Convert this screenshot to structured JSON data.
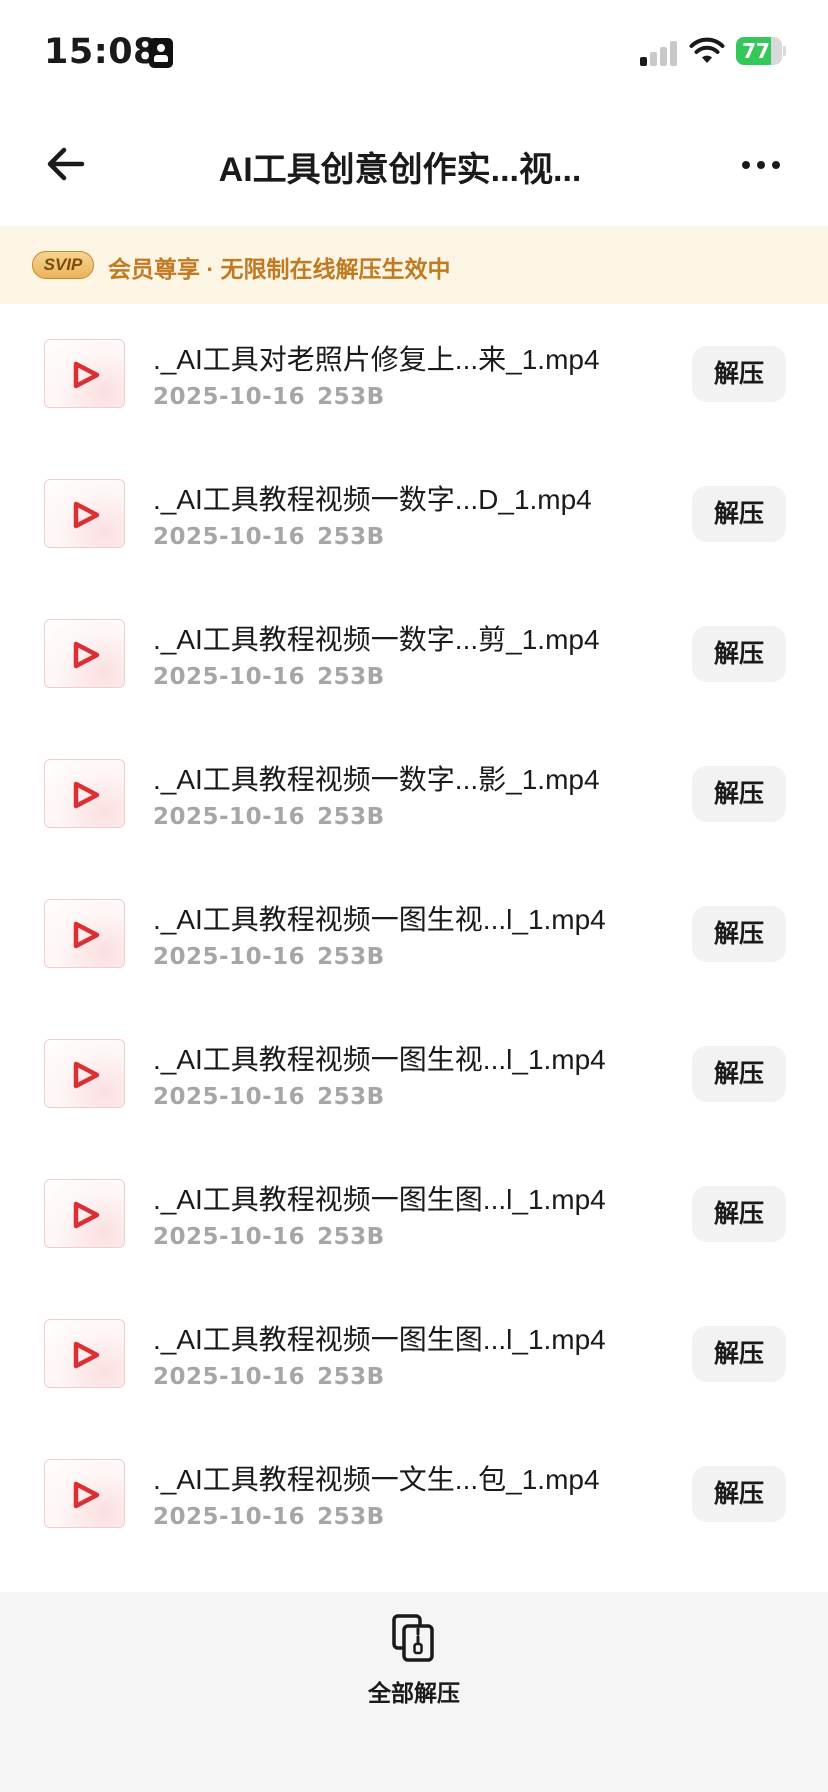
{
  "status_bar": {
    "time": "15:08",
    "battery_percent": "77",
    "battery_level": 0.77,
    "signal_bars_active": 1,
    "signal_bars_total": 4,
    "colors": {
      "battery": "#34c759",
      "signal_active": "#1a1a1a",
      "signal_inactive": "#c8c8c8"
    }
  },
  "nav": {
    "title": "AI工具创意创作实...视...",
    "back_icon": "arrow-left-icon",
    "more_icon": "more-horizontal-icon"
  },
  "banner": {
    "badge": "SVIP",
    "text": "会员尊享 · 无限制在线解压生效中",
    "colors": {
      "background": "#fdf5e4",
      "text": "#c07a22"
    }
  },
  "files": [
    {
      "name": "._AI工具对老照片修复上...来_1.mp4",
      "date": "2025-10-16",
      "size": "253B",
      "action": "解压"
    },
    {
      "name": "._AI工具教程视频一数字...D_1.mp4",
      "date": "2025-10-16",
      "size": "253B",
      "action": "解压"
    },
    {
      "name": "._AI工具教程视频一数字...剪_1.mp4",
      "date": "2025-10-16",
      "size": "253B",
      "action": "解压"
    },
    {
      "name": "._AI工具教程视频一数字...影_1.mp4",
      "date": "2025-10-16",
      "size": "253B",
      "action": "解压"
    },
    {
      "name": "._AI工具教程视频一图生视...l_1.mp4",
      "date": "2025-10-16",
      "size": "253B",
      "action": "解压"
    },
    {
      "name": "._AI工具教程视频一图生视...l_1.mp4",
      "date": "2025-10-16",
      "size": "253B",
      "action": "解压"
    },
    {
      "name": "._AI工具教程视频一图生图...l_1.mp4",
      "date": "2025-10-16",
      "size": "253B",
      "action": "解压"
    },
    {
      "name": "._AI工具教程视频一图生图...l_1.mp4",
      "date": "2025-10-16",
      "size": "253B",
      "action": "解压"
    },
    {
      "name": "._AI工具教程视频一文生...包_1.mp4",
      "date": "2025-10-16",
      "size": "253B",
      "action": "解压"
    }
  ],
  "file_icon": "video-play-icon",
  "bottom": {
    "extract_all_label": "全部解压",
    "extract_all_icon": "archive-zip-icon"
  }
}
